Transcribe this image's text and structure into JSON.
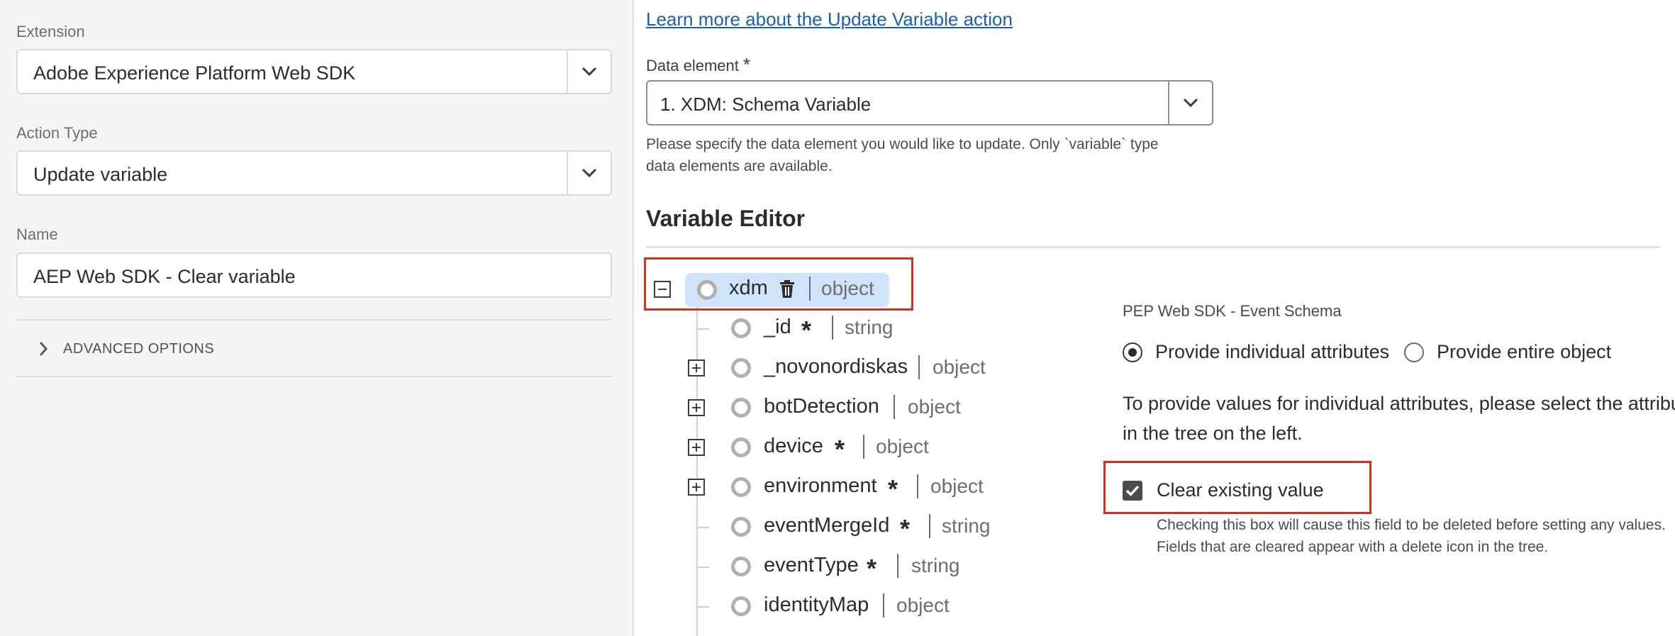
{
  "left": {
    "extension": {
      "label": "Extension",
      "value": "Adobe Experience Platform Web SDK"
    },
    "action_type": {
      "label": "Action Type",
      "value": "Update variable"
    },
    "name": {
      "label": "Name",
      "value": "AEP Web SDK - Clear variable"
    },
    "advanced_options": "ADVANCED OPTIONS"
  },
  "main": {
    "learn_link": "Learn more about the Update Variable action",
    "data_element": {
      "label": "Data element",
      "required_mark": "*",
      "value": "1. XDM: Schema Variable",
      "help_line1": "Please specify the data element you would like to update. Only `variable` type",
      "help_line2": "data elements are available."
    },
    "variable_editor": {
      "title": "Variable Editor",
      "tree": {
        "root": {
          "name": "xdm",
          "type": "object"
        },
        "nodes": [
          {
            "name": "_id",
            "required": true,
            "type": "string",
            "expandable": false
          },
          {
            "name": "_novonordiskas",
            "required": false,
            "type": "object",
            "expandable": true
          },
          {
            "name": "botDetection",
            "required": false,
            "type": "object",
            "expandable": true
          },
          {
            "name": "device",
            "required": true,
            "type": "object",
            "expandable": true
          },
          {
            "name": "environment",
            "required": true,
            "type": "object",
            "expandable": true
          },
          {
            "name": "eventMergeId",
            "required": true,
            "type": "string",
            "expandable": false
          },
          {
            "name": "eventType",
            "required": true,
            "type": "string",
            "expandable": false
          },
          {
            "name": "identityMap",
            "required": false,
            "type": "object",
            "expandable": false
          }
        ]
      },
      "details": {
        "schema_label": "PEP Web SDK - Event Schema",
        "option_individual": "Provide individual attributes",
        "option_entire": "Provide entire object",
        "selected_option": "individual",
        "attr_help_line1": "To provide values for individual attributes, please select the attributes",
        "attr_help_line2": "in the tree on the left.",
        "clear_label": "Clear existing value",
        "clear_checked": true,
        "clear_help_line1": "Checking this box will cause this field to be deleted before setting any values.",
        "clear_help_line2": "Fields that are cleared appear with a delete icon in the tree."
      }
    }
  },
  "colors": {
    "highlight": "#d4321e",
    "link": "#1a5fb4",
    "selected_node": "#cfe4fa"
  }
}
